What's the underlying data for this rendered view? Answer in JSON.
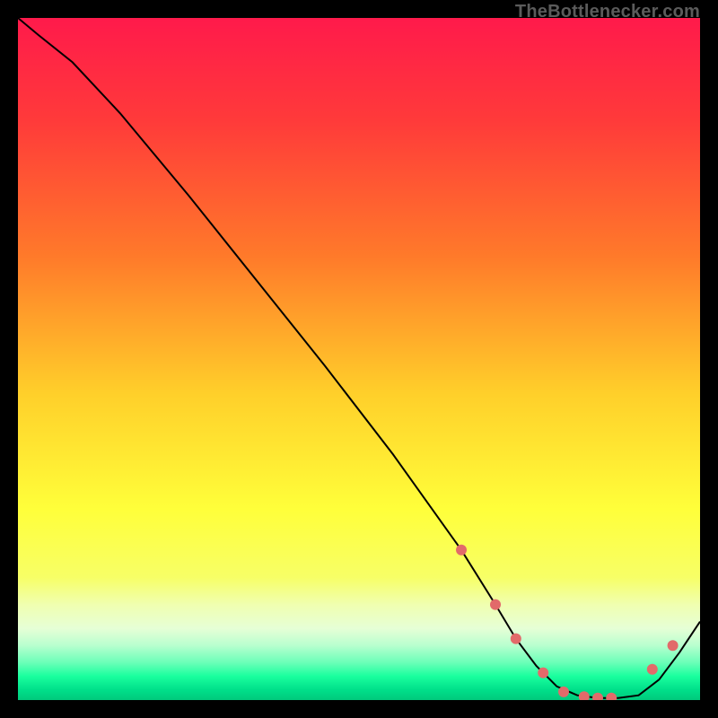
{
  "attribution": "TheBottlenecker.com",
  "chart_data": {
    "type": "line",
    "title": "",
    "xlabel": "",
    "ylabel": "",
    "xlim": [
      0,
      100
    ],
    "ylim": [
      0,
      100
    ],
    "x": [
      0,
      3,
      8,
      15,
      25,
      35,
      45,
      55,
      65,
      70,
      73,
      76,
      79,
      82,
      85,
      88,
      91,
      94,
      97,
      100
    ],
    "values": [
      100,
      97.5,
      93.5,
      86,
      74,
      61.5,
      49,
      36,
      22,
      14,
      9,
      5,
      2,
      0.7,
      0.3,
      0.3,
      0.7,
      3,
      7,
      11.5
    ],
    "markers_x": [
      65,
      70,
      73,
      77,
      80,
      83,
      85,
      87,
      93,
      96
    ],
    "markers_y": [
      22,
      14,
      9,
      4,
      1.2,
      0.5,
      0.3,
      0.3,
      4.5,
      8
    ],
    "gradient_stops": [
      {
        "offset": 0.0,
        "color": "#ff1a4b"
      },
      {
        "offset": 0.15,
        "color": "#ff3a3a"
      },
      {
        "offset": 0.35,
        "color": "#ff7a2a"
      },
      {
        "offset": 0.55,
        "color": "#ffcf2a"
      },
      {
        "offset": 0.72,
        "color": "#ffff3a"
      },
      {
        "offset": 0.82,
        "color": "#f7ff66"
      },
      {
        "offset": 0.86,
        "color": "#f0ffb0"
      },
      {
        "offset": 0.895,
        "color": "#e6ffd6"
      },
      {
        "offset": 0.92,
        "color": "#b8ffcf"
      },
      {
        "offset": 0.945,
        "color": "#6bffb8"
      },
      {
        "offset": 0.965,
        "color": "#1aff9e"
      },
      {
        "offset": 0.985,
        "color": "#00e08a"
      },
      {
        "offset": 1.0,
        "color": "#00c97c"
      }
    ],
    "marker_color": "#e26a6a",
    "line_color": "#000000"
  }
}
